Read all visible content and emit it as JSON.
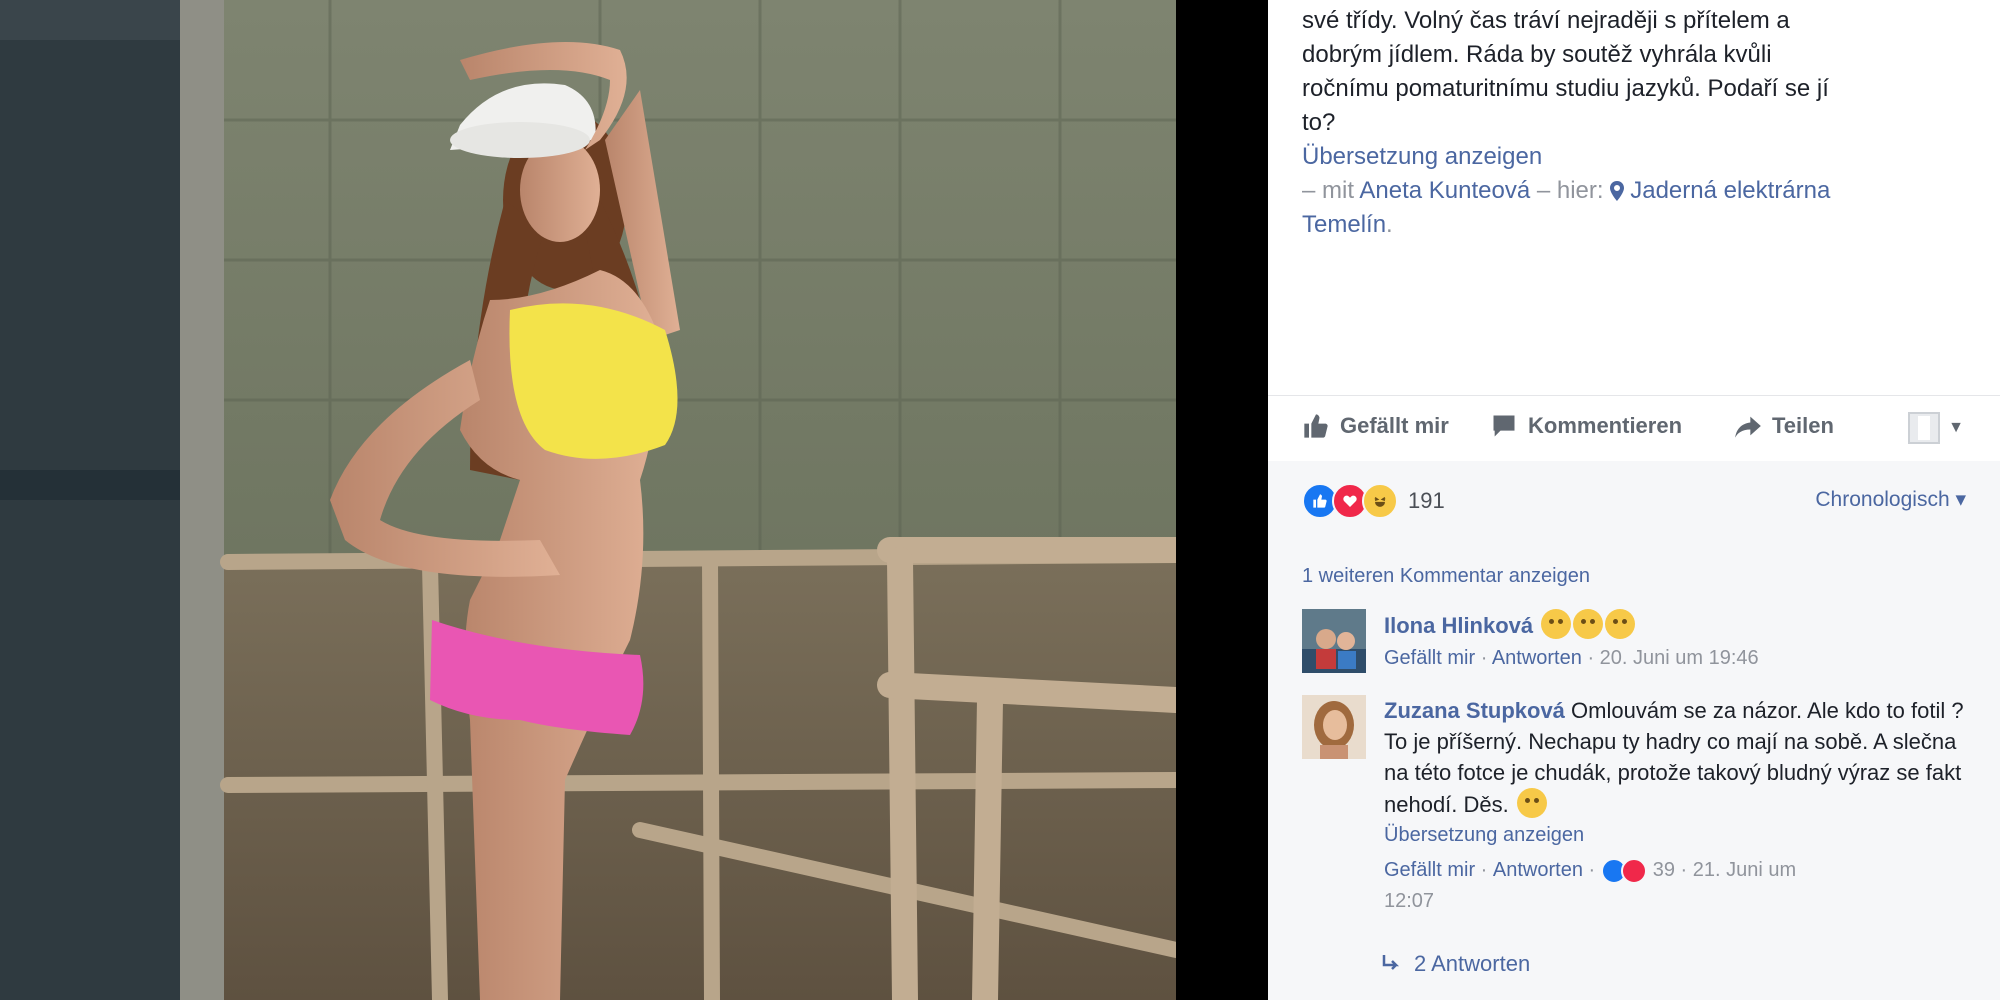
{
  "caption": {
    "lines": [
      "své třídy. Volný čas tráví nejraději s přítelem a",
      "dobrým jídlem. Ráda by soutěž vyhrála kvůli",
      "ročnímu pomaturitnímu studiu jazyků. Podaří se jí",
      "to?"
    ],
    "translate": "Übersetzung anzeigen",
    "with_prefix": "– mit",
    "with_name": "Aneta Kunteová",
    "here": "– hier:",
    "place_line1": "Jaderná elektrárna",
    "place_line2": "Temelín",
    "period": "."
  },
  "actions": {
    "like": "Gefällt mir",
    "comment": "Kommentieren",
    "share": "Teilen"
  },
  "reactions": {
    "count": "191",
    "sort": "Chronologisch ▾"
  },
  "more_comments": "1 weiteren Kommentar anzeigen",
  "comments": [
    {
      "name": "Ilona Hlinková",
      "text": "",
      "like": "Gefällt mir",
      "reply": "Antworten",
      "time": "20. Juni um 19:46"
    },
    {
      "name": "Zuzana Stupková",
      "text": "Omlouvám se za názor. Ale kdo to fotil ? To je příšerný. Nechapu ty hadry co mají na sobě. A slečna na této fotce je chudák, protože takový bludný výraz se fakt nehodí. Děs.",
      "translate": "Übersetzung anzeigen",
      "like": "Gefällt mir",
      "reply": "Antworten",
      "reactions": "39",
      "time1": "21. Juni um",
      "time2": "12:07"
    }
  ],
  "replies": "2 Antworten",
  "colors": {
    "link": "#4b67a1",
    "like_blue": "#1877f2",
    "love_red": "#f0284a",
    "haha_yellow": "#f7c948"
  }
}
